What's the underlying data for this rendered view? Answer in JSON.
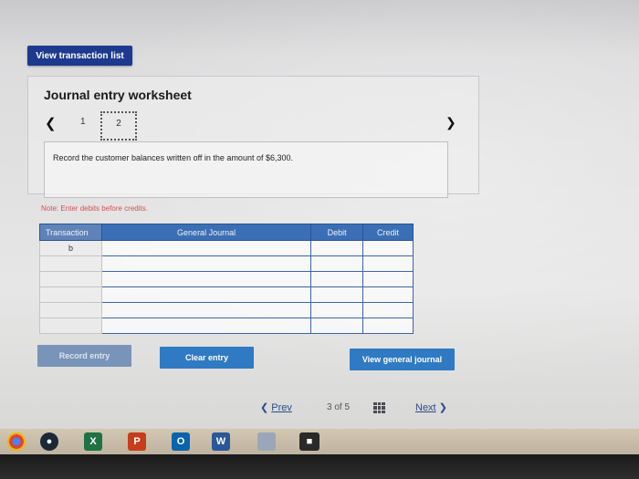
{
  "top_button": {
    "label": "View transaction list"
  },
  "worksheet": {
    "title": "Journal entry worksheet",
    "pages": [
      "1",
      "2"
    ],
    "current_page": "2",
    "instruction": "Record the customer balances written off in the amount of $6,300.",
    "note": "Note: Enter debits before credits."
  },
  "journal_table": {
    "headers": [
      "Transaction",
      "General Journal",
      "Debit",
      "Credit"
    ],
    "rows": [
      [
        "b",
        "",
        "",
        ""
      ],
      [
        "",
        "",
        "",
        ""
      ],
      [
        "",
        "",
        "",
        ""
      ],
      [
        "",
        "",
        "",
        ""
      ],
      [
        "",
        "",
        "",
        ""
      ],
      [
        "",
        "",
        "",
        ""
      ]
    ]
  },
  "actions": {
    "record": "Record entry",
    "clear": "Clear entry",
    "view_journal": "View general journal"
  },
  "footer": {
    "prev": "Prev",
    "page_of": "3 of 5",
    "next": "Next"
  },
  "taskbar": {
    "icons": [
      "chrome-icon",
      "steam-icon",
      "excel-icon",
      "powerpoint-icon",
      "outlook-icon",
      "word-icon",
      "notes-icon",
      "terminal-icon"
    ]
  },
  "colors": {
    "primary_button": "#1e3a8e",
    "action_button": "#2f7ac2",
    "table_header": "#3a6fb5",
    "note_text": "#d35050"
  }
}
